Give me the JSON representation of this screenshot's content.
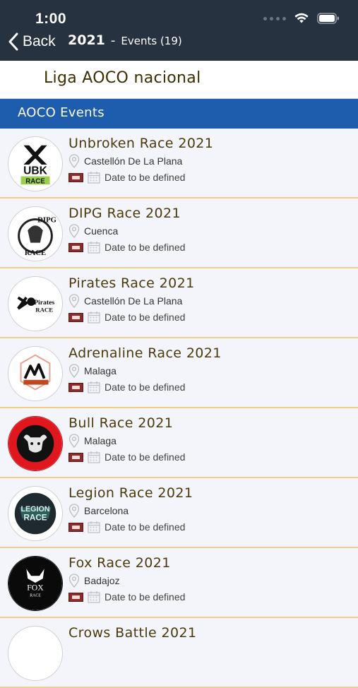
{
  "status_bar": {
    "time": "1:00"
  },
  "nav": {
    "back_label": "Back",
    "year": "2021",
    "separator": "-",
    "subtitle": "Events (19)"
  },
  "league": {
    "name": "Liga AOCO nacional"
  },
  "section": {
    "title": "AOCO Events"
  },
  "events": [
    {
      "title": "Unbroken Race 2021",
      "location": "Castellón De La Plana",
      "date": "Date to be defined",
      "logo": "ubk-race-logo"
    },
    {
      "title": "DIPG Race 2021",
      "location": "Cuenca",
      "date": "Date to be defined",
      "logo": "dipg-race-logo"
    },
    {
      "title": "Pirates Race 2021",
      "location": "Castellón De La Plana",
      "date": "Date to be defined",
      "logo": "pirates-race-logo"
    },
    {
      "title": "Adrenaline Race 2021",
      "location": "Malaga",
      "date": "Date to be defined",
      "logo": "adrenaline-race-logo"
    },
    {
      "title": "Bull Race 2021",
      "location": "Malaga",
      "date": "Date to be defined",
      "logo": "bull-race-logo"
    },
    {
      "title": "Legion Race 2021",
      "location": "Barcelona",
      "date": "Date to be defined",
      "logo": "legion-race-logo"
    },
    {
      "title": "Fox Race 2021",
      "location": "Badajoz",
      "date": "Date to be defined",
      "logo": "fox-race-logo"
    },
    {
      "title": "Crows Battle 2021",
      "location": "",
      "date": "",
      "logo": "crows-battle-logo"
    }
  ],
  "colors": {
    "nav_bg": "#273240",
    "section_bg": "#1e5cae",
    "row_bg": "#f4f5fa",
    "row_divider": "#f1cd8c",
    "title_text": "#4a3a0c"
  },
  "logo_text": {
    "ubk": "UBK",
    "ubk_sub": "RACE",
    "dipg": "DIPG",
    "dipg_sub": "RACE",
    "pirates": "Pirates",
    "pirates_sub": "RACE",
    "legion": "LEGION",
    "legion_sub": "RACE",
    "fox": "FOX",
    "fox_sub": "RACE"
  }
}
